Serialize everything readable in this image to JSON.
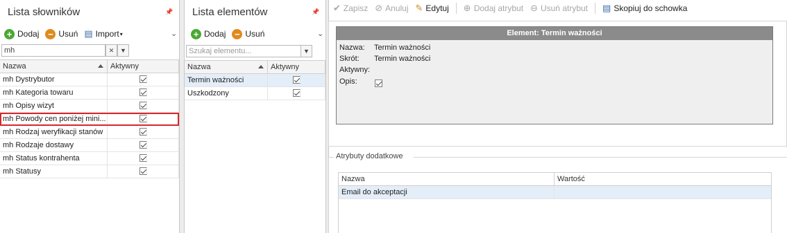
{
  "dictionaries": {
    "title": "Lista słowników",
    "toolbar": {
      "add": "Dodaj",
      "remove": "Usuń",
      "import": "Import"
    },
    "search_value": "mh",
    "columns": {
      "name": "Nazwa",
      "active": "Aktywny"
    },
    "rows": [
      {
        "name": "mh Dystrybutor",
        "active": true
      },
      {
        "name": "mh Kategoria towaru",
        "active": true
      },
      {
        "name": "mh Opisy wizyt",
        "active": true
      },
      {
        "name": "mh Powody cen poniżej mini...",
        "active": true,
        "highlighted": true
      },
      {
        "name": "mh Rodzaj weryfikacji stanów",
        "active": true
      },
      {
        "name": "mh Rodzaje dostawy",
        "active": true
      },
      {
        "name": "mh Status kontrahenta",
        "active": true
      },
      {
        "name": "mh Statusy",
        "active": true
      }
    ]
  },
  "elements": {
    "title": "Lista elementów",
    "toolbar": {
      "add": "Dodaj",
      "remove": "Usuń"
    },
    "search_placeholder": "Szukaj elementu...",
    "columns": {
      "name": "Nazwa",
      "active": "Aktywny"
    },
    "rows": [
      {
        "name": "Termin ważności",
        "active": true,
        "selected": true
      },
      {
        "name": "Uszkodzony",
        "active": true
      }
    ]
  },
  "actions": {
    "save": "Zapisz",
    "cancel": "Anuluj",
    "edit": "Edytuj",
    "add_attribute": "Dodaj atrybut",
    "remove_attribute": "Usuń atrybut",
    "copy": "Skopiuj do schowka"
  },
  "detail": {
    "header": "Element: Termin ważności",
    "labels": {
      "name": "Nazwa:",
      "short": "Skrót:",
      "active": "Aktywny:",
      "description": "Opis:"
    },
    "values": {
      "name": "Termin ważności",
      "short": "Termin ważności",
      "active": true,
      "description": ""
    }
  },
  "attributes": {
    "group_title": "Atrybuty dodatkowe",
    "columns": {
      "name": "Nazwa",
      "value": "Wartość"
    },
    "rows": [
      {
        "name": "Email do akceptacji",
        "value": ""
      }
    ]
  },
  "colors": {
    "highlight_border": "#d9262a",
    "selected_row": "#e4eef8",
    "element_header": "#8b8b8b"
  }
}
